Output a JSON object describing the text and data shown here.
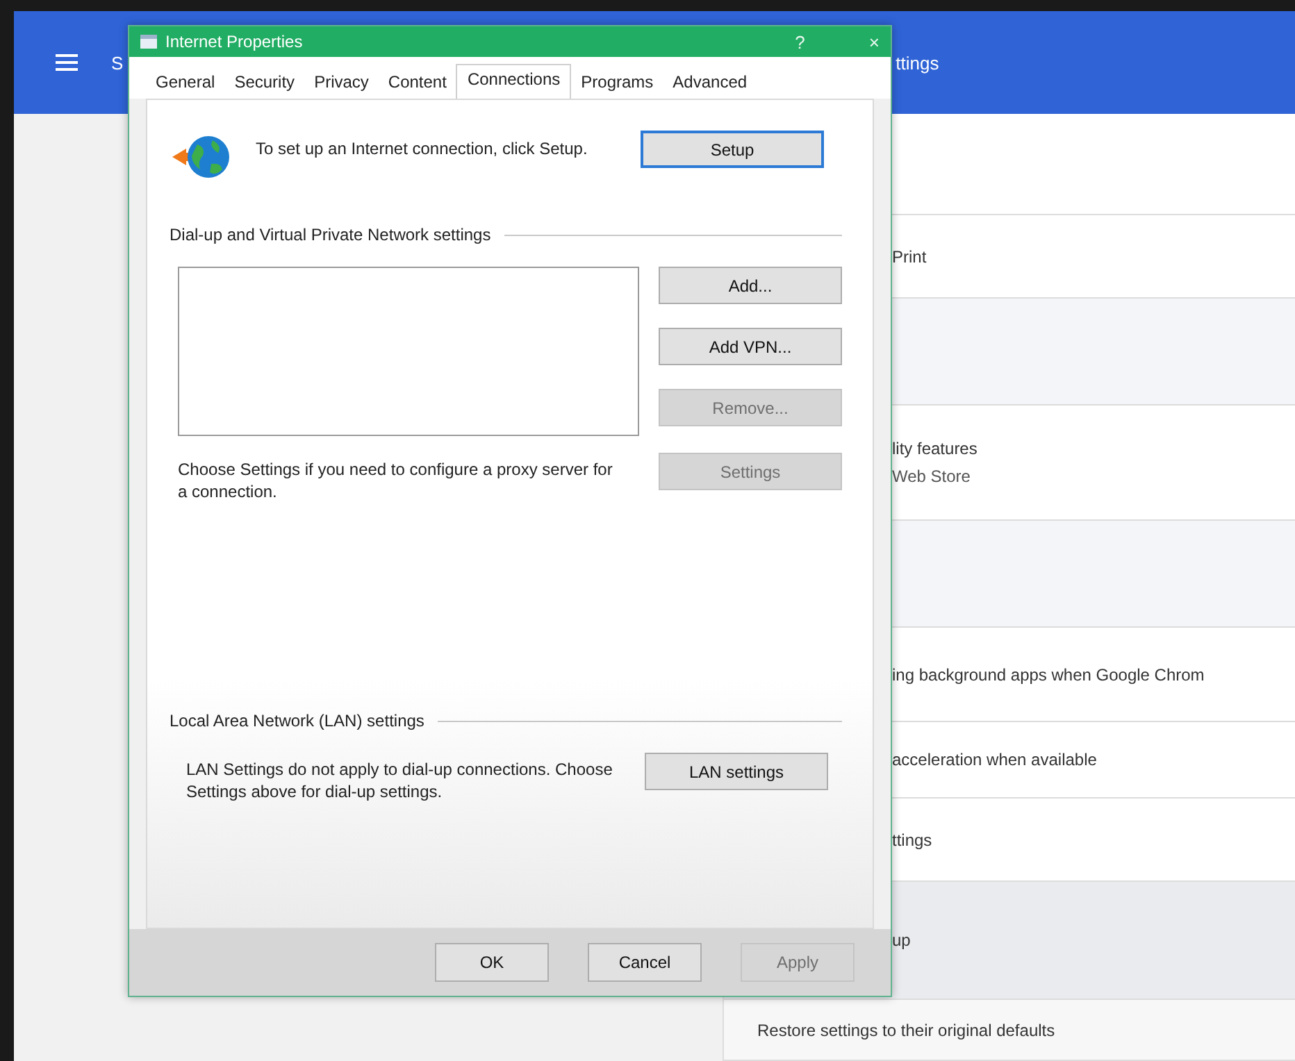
{
  "background_page": {
    "header": {
      "title_fragments": [
        "S",
        "ttings"
      ]
    },
    "rows": [
      {
        "kind": "blank"
      },
      {
        "kind": "partial",
        "lines": [
          "Print"
        ]
      },
      {
        "kind": "gap"
      },
      {
        "kind": "partial",
        "lines": [
          "lity features",
          "Web Store"
        ]
      },
      {
        "kind": "gap"
      },
      {
        "kind": "partial",
        "lines": [
          "ing background apps when Google Chrom"
        ]
      },
      {
        "kind": "partial",
        "lines": [
          "acceleration when available"
        ]
      },
      {
        "kind": "partial",
        "lines": [
          "ttings"
        ]
      },
      {
        "kind": "section",
        "lines": [
          "up"
        ]
      },
      {
        "kind": "row",
        "lines": [
          "Restore settings to their original defaults"
        ]
      }
    ]
  },
  "dialog": {
    "title": "Internet Properties",
    "title_buttons": [
      "?",
      "×"
    ],
    "tabs": [
      {
        "label": "General",
        "selected": false
      },
      {
        "label": "Security",
        "selected": false
      },
      {
        "label": "Privacy",
        "selected": false
      },
      {
        "label": "Content",
        "selected": false
      },
      {
        "label": "Connections",
        "selected": true
      },
      {
        "label": "Programs",
        "selected": false
      },
      {
        "label": "Advanced",
        "selected": false
      }
    ],
    "setup": {
      "text": "To set up an Internet connection, click Setup.",
      "button": {
        "label": "Setup",
        "disabled": false,
        "focused": true
      }
    },
    "dialup": {
      "heading": "Dial-up and Virtual Private Network settings",
      "buttons": [
        {
          "label": "Add...",
          "disabled": false
        },
        {
          "label": "Add VPN...",
          "disabled": false
        },
        {
          "label": "Remove...",
          "disabled": true
        },
        {
          "label": "Settings",
          "disabled": true
        }
      ],
      "proxy_text": "Choose Settings if you need to configure a proxy server for a connection."
    },
    "lan": {
      "heading": "Local Area Network (LAN) settings",
      "text": "LAN Settings do not apply to dial-up connections. Choose Settings above for dial-up settings.",
      "button": {
        "label": "LAN settings",
        "disabled": false
      }
    },
    "footer_buttons": [
      {
        "label": "OK",
        "disabled": false
      },
      {
        "label": "Cancel",
        "disabled": false
      },
      {
        "label": "Apply",
        "disabled": true
      }
    ]
  }
}
